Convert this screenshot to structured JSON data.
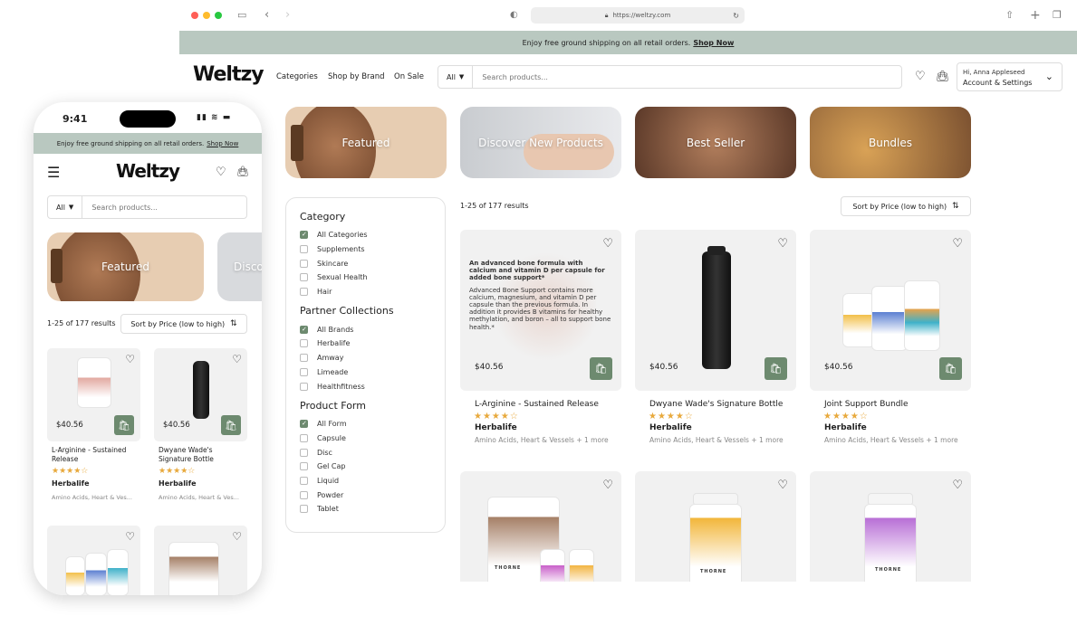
{
  "browser": {
    "url": "https://weltzy.com"
  },
  "banner": {
    "text": "Enjoy free ground shipping on all retail orders.",
    "link": "Shop Now"
  },
  "brand": "Weltzy",
  "nav": [
    "Categories",
    "Shop by Brand",
    "On Sale"
  ],
  "search": {
    "scope": "All",
    "placeholder": "Search products..."
  },
  "account": {
    "greeting": "Hi, Anna Appleseed",
    "label": "Account & Settings"
  },
  "heroes": [
    "Featured",
    "Discover New Products",
    "Best Seller",
    "Bundles"
  ],
  "filters": {
    "category": {
      "title": "Category",
      "options": [
        "All Categories",
        "Supplements",
        "Skincare",
        "Sexual Health",
        "Hair"
      ]
    },
    "partner": {
      "title": "Partner Collections",
      "options": [
        "All Brands",
        "Herbalife",
        "Amway",
        "Limeade",
        "Healthfitness"
      ]
    },
    "form": {
      "title": "Product Form",
      "options": [
        "All Form",
        "Capsule",
        "Disc",
        "Gel Cap",
        "Liquid",
        "Powder",
        "Tablet"
      ]
    }
  },
  "results": {
    "count": "1-25 of 177 results",
    "sort": "Sort by Price (low to high)"
  },
  "products": [
    {
      "name": "L-Arginine - Sustained Release",
      "price": "$40.56",
      "brand": "Herbalife",
      "tags": "Amino Acids, Heart & Vessels + 1 more",
      "stars": "★★★★☆",
      "desc_title": "An advanced bone formula with calcium and vitamin D per capsule for added bone support*",
      "desc": "Advanced Bone Support contains more calcium, magnesium, and vitamin D per capsule than the previous formula. In addition it provides B vitamins for healthy methylation, and boron – all to support bone health.*"
    },
    {
      "name": "Dwyane Wade's Signature Bottle",
      "price": "$40.56",
      "brand": "Herbalife",
      "tags": "Amino Acids, Heart & Vessels + 1 more",
      "stars": "★★★★☆"
    },
    {
      "name": "Joint Support Bundle",
      "price": "$40.56",
      "brand": "Herbalife",
      "tags": "Amino Acids, Heart & Vessels + 1 more",
      "stars": "★★★★☆"
    }
  ],
  "jar_labels": [
    "THORNE",
    "THORNE",
    "THORNE",
    "THORNE"
  ],
  "phone": {
    "time": "9:41",
    "heroes": [
      "Featured",
      "Disco"
    ],
    "results": "1-25 of 177 results",
    "products": [
      {
        "name": "L-Arginine - Sustained Release",
        "price": "$40.56",
        "brand": "Herbalife",
        "tags": "Amino Acids, Heart & Ves...",
        "stars": "★★★★☆"
      },
      {
        "name": "Dwyane Wade's Signature Bottle",
        "price": "$40.56",
        "brand": "Herbalife",
        "tags": "Amino Acids, Heart & Ves...",
        "stars": "★★★★☆"
      }
    ]
  },
  "colors": {
    "accent": "#6d8a6f",
    "banner": "#b9c8c0",
    "star": "#e8a93c"
  }
}
